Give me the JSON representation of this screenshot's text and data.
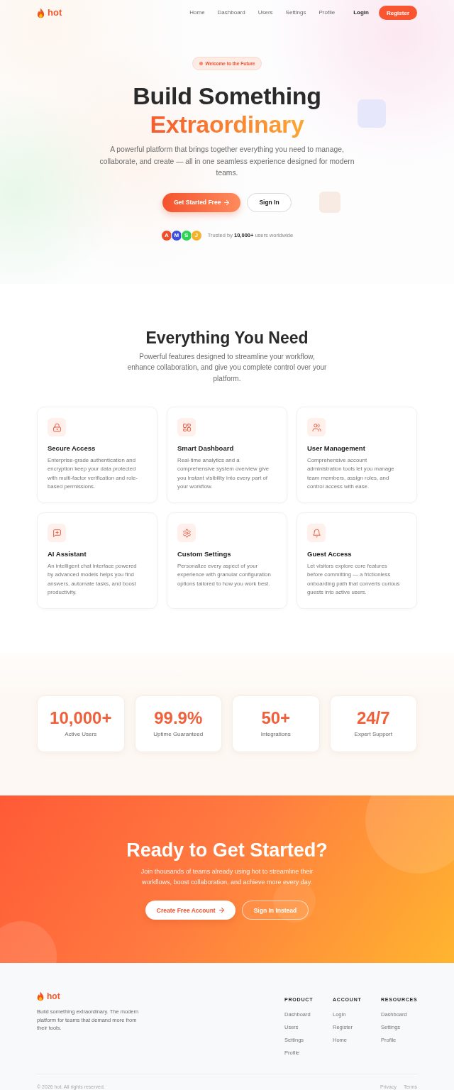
{
  "header": {
    "logo": "hot",
    "nav": [
      {
        "label": "Home"
      },
      {
        "label": "Dashboard"
      },
      {
        "label": "Users"
      },
      {
        "label": "Settings"
      },
      {
        "label": "Profile"
      }
    ],
    "login": "Login",
    "register": "Register"
  },
  "hero": {
    "badge": "Welcome to the Future",
    "title": "Build Something",
    "title_highlight": "Extraordinary",
    "subtitle": "A powerful platform that brings together everything you need to manage, collaborate, and create — all in one seamless experience designed for modern teams.",
    "primary_button": "Get Started Free",
    "secondary_button": "Sign In",
    "trust": {
      "avatars": [
        {
          "initial": "A",
          "color": "#ef4e2b"
        },
        {
          "initial": "M",
          "color": "#3b50e0"
        },
        {
          "initial": "S",
          "color": "#2bd452"
        },
        {
          "initial": "J",
          "color": "#f5b22b"
        }
      ],
      "text": "Trusted by **10,000+** users worldwide"
    }
  },
  "features": {
    "title": "Everything You Need",
    "subtitle": "Powerful features designed to streamline your workflow, enhance collaboration, and give you complete control over your platform.",
    "cards": [
      {
        "title": "Secure Access",
        "description": "Enterprise-grade authentication and encryption keep your data protected with multi-factor verification and role-based permissions."
      },
      {
        "title": "Smart Dashboard",
        "description": "Real-time analytics and a comprehensive system overview give you instant visibility into every part of your workflow."
      },
      {
        "title": "User Management",
        "description": "Comprehensive account administration tools let you manage team members, assign roles, and control access with ease."
      },
      {
        "title": "AI Assistant",
        "description": "An intelligent chat interface powered by advanced models helps you find answers, automate tasks, and boost productivity."
      },
      {
        "title": "Custom Settings",
        "description": "Personalize every aspect of your experience with granular configuration options tailored to how you work best."
      },
      {
        "title": "Guest Access",
        "description": "Let visitors explore core features before committing — a frictionless onboarding path that converts curious guests into active users."
      }
    ]
  },
  "stats": [
    {
      "value": "10,000+",
      "label": "Active Users"
    },
    {
      "value": "99.9%",
      "label": "Uptime Guaranteed"
    },
    {
      "value": "50+",
      "label": "Integrations"
    },
    {
      "value": "24/7",
      "label": "Expert Support"
    }
  ],
  "cta": {
    "title": "Ready to Get Started?",
    "text": "Join thousands of teams already using hot to streamline their workflows, boost collaboration, and achieve more every day.",
    "primary_button": "Create Free Account",
    "secondary_button": "Sign In Instead"
  },
  "footer": {
    "logo": "hot",
    "description": "Build something extraordinary. The modern platform for teams that demand more from their tools.",
    "columns": [
      {
        "heading": "PRODUCT",
        "links": [
          "Dashboard",
          "Users",
          "Settings",
          "Profile"
        ]
      },
      {
        "heading": "ACCOUNT",
        "links": [
          "Login",
          "Register",
          "Home"
        ]
      },
      {
        "heading": "RESOURCES",
        "links": [
          "Dashboard",
          "Settings",
          "Profile"
        ]
      }
    ],
    "copyright": "© 2026 hot. All rights reserved.",
    "legal": [
      "Privacy",
      "Terms"
    ]
  }
}
